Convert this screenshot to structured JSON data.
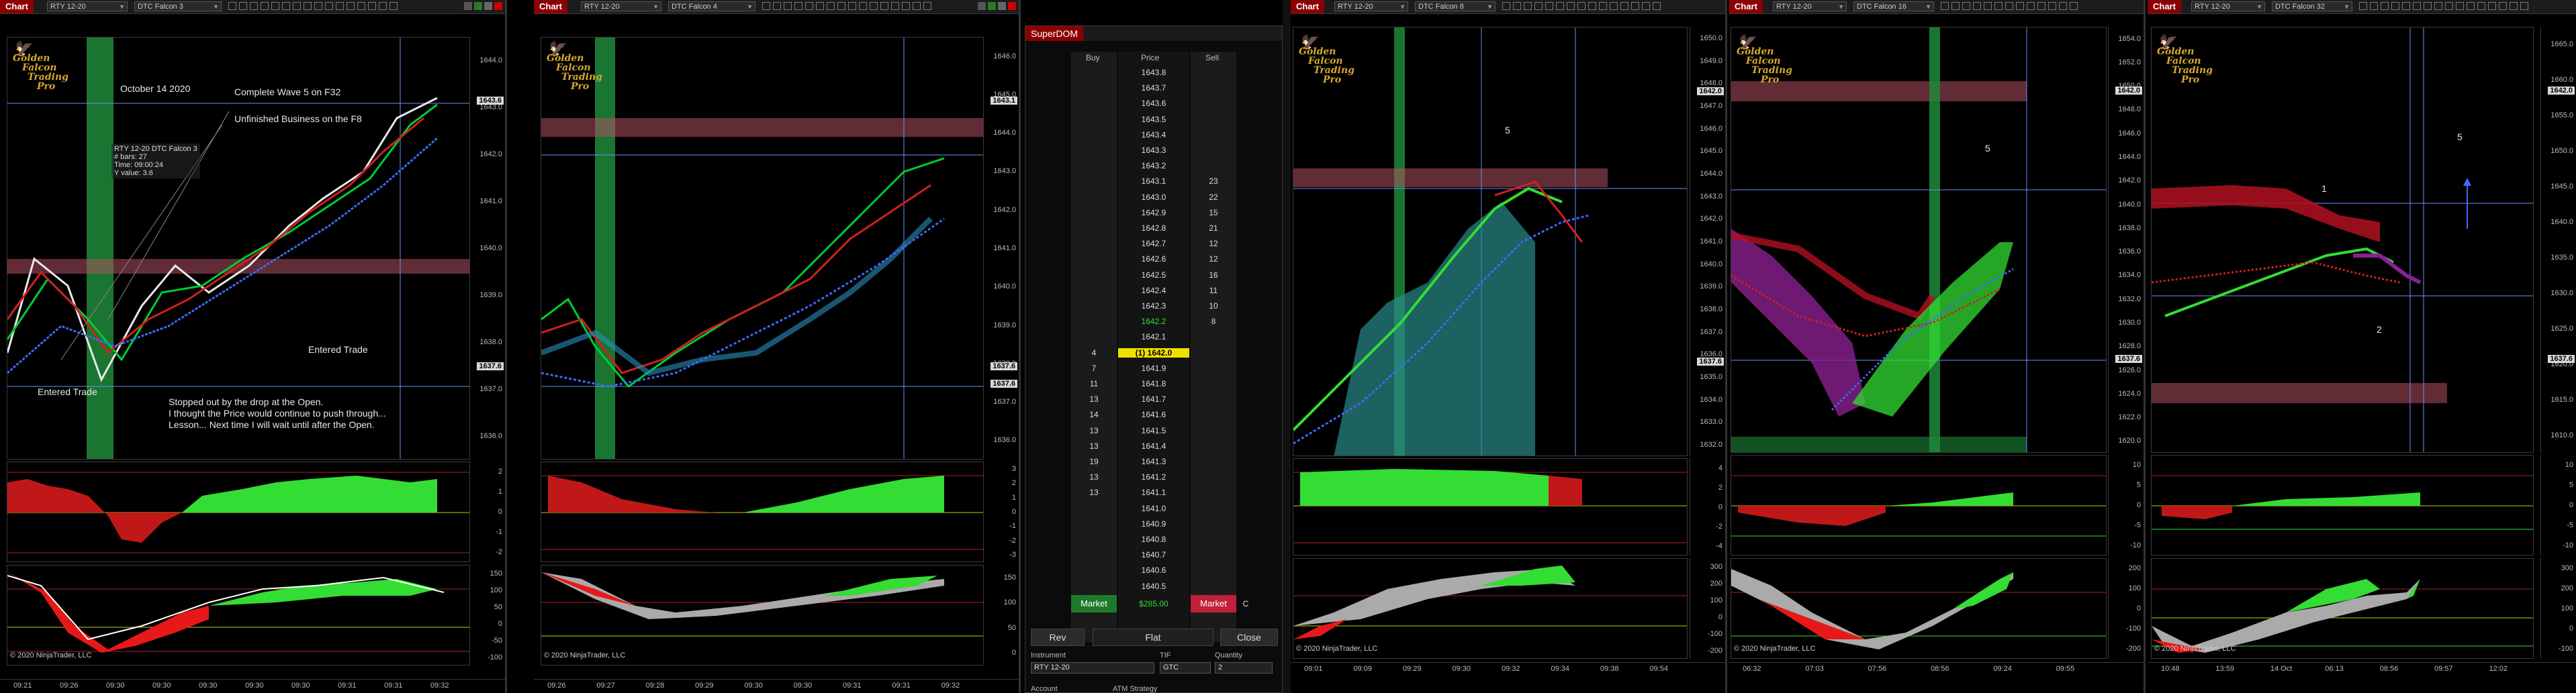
{
  "windows": [
    {
      "tab": "Chart",
      "instrument": "RTY 12-20",
      "template": "DTC Falcon 3"
    },
    {
      "tab": "Chart",
      "instrument": "RTY 12-20",
      "template": "DTC Falcon 4"
    },
    {
      "tab": "Chart",
      "instrument": "RTY 12-20",
      "template": "DTC Falcon 8"
    },
    {
      "tab": "Chart",
      "instrument": "RTY 12-20",
      "template": "DTC Falcon 16"
    },
    {
      "tab": "Chart",
      "instrument": "RTY 12-20",
      "template": "DTC Falcon 32"
    }
  ],
  "logo": {
    "line1": "Golden",
    "line2": "Falcon",
    "line3": "Trading",
    "line4": "Pro"
  },
  "copyright": "© 2020 NinjaTrader, LLC",
  "chart1": {
    "date_note": "October 14 2020",
    "note_wave": "Complete Wave 5 on F32",
    "note_unfinished": "Unfinished Business on the F8",
    "note_entered_right": "Entered Trade",
    "note_entered_left": "Entered Trade",
    "note_stopped_1": "Stopped out by the drop at the Open.",
    "note_stopped_2": "I thought the Price would continue to push through...",
    "note_stopped_3": "Lesson... Next time I will wait until after the Open.",
    "databox": [
      "RTY 12-20  DTC Falcon 3",
      "# bars:    27",
      "Time:      09:00:24",
      "Y value:  3.6"
    ],
    "price_ticks": [
      "1644.0",
      "1643.0",
      "1642.0",
      "1641.0",
      "1640.0",
      "1639.0",
      "1638.0",
      "1637.0",
      "1636.0"
    ],
    "price_flags": [
      "1643.6",
      "1637.6"
    ],
    "osc1_ticks": [
      "2",
      "1",
      "0",
      "-1",
      "-2"
    ],
    "osc2_ticks": [
      "150",
      "100",
      "50",
      "0",
      "-50",
      "-100"
    ],
    "times": [
      "09:21",
      "09:26",
      "09:30",
      "09:30",
      "09:30",
      "09:30",
      "09:30",
      "09:31",
      "09:31",
      "09:32"
    ]
  },
  "chart2": {
    "price_ticks": [
      "1646.0",
      "1645.0",
      "1644.0",
      "1643.0",
      "1642.0",
      "1641.0",
      "1640.0",
      "1639.0",
      "1638.0",
      "1637.0",
      "1636.0"
    ],
    "price_flags": [
      "1643.1",
      "1637.6",
      "1637.6"
    ],
    "osc1_ticks": [
      "3",
      "2",
      "1",
      "0",
      "-1",
      "-2",
      "-3"
    ],
    "osc2_ticks": [
      "150",
      "100",
      "50",
      "0"
    ],
    "times": [
      "09:26",
      "09:27",
      "09:28",
      "09:29",
      "09:30",
      "09:30",
      "09:31",
      "09:31",
      "09:32"
    ]
  },
  "superdom": {
    "tab": "SuperDOM",
    "hdr_buy": "Buy",
    "hdr_price": "Price",
    "hdr_sell": "Sell",
    "rows": [
      {
        "buy": "",
        "price": "1643.8",
        "sell": ""
      },
      {
        "buy": "",
        "price": "1643.7",
        "sell": ""
      },
      {
        "buy": "",
        "price": "1643.6",
        "sell": ""
      },
      {
        "buy": "",
        "price": "1643.5",
        "sell": ""
      },
      {
        "buy": "",
        "price": "1643.4",
        "sell": ""
      },
      {
        "buy": "",
        "price": "1643.3",
        "sell": ""
      },
      {
        "buy": "",
        "price": "1643.2",
        "sell": ""
      },
      {
        "buy": "",
        "price": "1643.1",
        "sell": "23"
      },
      {
        "buy": "",
        "price": "1643.0",
        "sell": "22"
      },
      {
        "buy": "",
        "price": "1642.9",
        "sell": "15"
      },
      {
        "buy": "",
        "price": "1642.8",
        "sell": "21"
      },
      {
        "buy": "",
        "price": "1642.7",
        "sell": "12"
      },
      {
        "buy": "",
        "price": "1642.6",
        "sell": "12"
      },
      {
        "buy": "",
        "price": "1642.5",
        "sell": "16"
      },
      {
        "buy": "",
        "price": "1642.4",
        "sell": "11"
      },
      {
        "buy": "",
        "price": "1642.3",
        "sell": "10"
      },
      {
        "buy": "",
        "price": "1642.2",
        "sell": "8"
      },
      {
        "buy": "",
        "price": "1642.1",
        "sell": ""
      },
      {
        "buy": "4",
        "price": "(1) 1642.0",
        "sell": ""
      },
      {
        "buy": "7",
        "price": "1641.9",
        "sell": ""
      },
      {
        "buy": "11",
        "price": "1641.8",
        "sell": ""
      },
      {
        "buy": "13",
        "price": "1641.7",
        "sell": ""
      },
      {
        "buy": "14",
        "price": "1641.6",
        "sell": ""
      },
      {
        "buy": "13",
        "price": "1641.5",
        "sell": ""
      },
      {
        "buy": "13",
        "price": "1641.4",
        "sell": ""
      },
      {
        "buy": "19",
        "price": "1641.3",
        "sell": ""
      },
      {
        "buy": "13",
        "price": "1641.2",
        "sell": ""
      },
      {
        "buy": "13",
        "price": "1641.1",
        "sell": ""
      },
      {
        "buy": "",
        "price": "1641.0",
        "sell": ""
      },
      {
        "buy": "",
        "price": "1640.9",
        "sell": ""
      },
      {
        "buy": "",
        "price": "1640.8",
        "sell": ""
      },
      {
        "buy": "",
        "price": "1640.7",
        "sell": ""
      },
      {
        "buy": "",
        "price": "1640.6",
        "sell": ""
      },
      {
        "buy": "",
        "price": "1640.5",
        "sell": ""
      }
    ],
    "market_buy": "Market",
    "pnl": "$285.00",
    "market_sell": "Market",
    "c_label": "C",
    "rev": "Rev",
    "flat": "Flat",
    "close": "Close",
    "lbl_instrument": "Instrument",
    "lbl_tif": "TIF",
    "lbl_quantity": "Quantity",
    "instrument": "RTY 12-20",
    "tif": "GTC",
    "quantity": "2",
    "lbl_account": "Account",
    "lbl_atm": "ATM Strategy"
  },
  "chart3": {
    "wave_label": "5",
    "price_ticks": [
      "1650.0",
      "1649.0",
      "1648.0",
      "1647.0",
      "1646.0",
      "1645.0",
      "1644.0",
      "1643.0",
      "1642.0",
      "1641.0",
      "1640.0",
      "1639.0",
      "1638.0",
      "1637.0",
      "1636.0",
      "1635.0",
      "1634.0",
      "1633.0",
      "1632.0"
    ],
    "price_flags": [
      "1642.0",
      "1637.6"
    ],
    "osc1_ticks": [
      "4",
      "2",
      "0",
      "-2",
      "-4"
    ],
    "osc2_ticks": [
      "300",
      "200",
      "100",
      "0",
      "-100",
      "-200"
    ],
    "times": [
      "09:01",
      "09:09",
      "09:29",
      "09:30",
      "09:32",
      "09:34",
      "09:38",
      "09:54"
    ]
  },
  "chart4": {
    "wave_label": "5",
    "price_ticks": [
      "1654.0",
      "1652.0",
      "1650.0",
      "1648.0",
      "1646.0",
      "1644.0",
      "1642.0",
      "1640.0",
      "1638.0",
      "1636.0",
      "1634.0",
      "1632.0",
      "1630.0",
      "1628.0",
      "1626.0",
      "1624.0",
      "1622.0",
      "1620.0"
    ],
    "price_flags": [
      "1642.0",
      "1637.6"
    ],
    "osc1_ticks": [
      "10",
      "5",
      "0",
      "-5",
      "-10"
    ],
    "osc2_ticks": [
      "200",
      "100",
      "0",
      "-100",
      "-200"
    ],
    "times": [
      "06:32",
      "07:03",
      "07:56",
      "08:56",
      "09:24",
      "09:55"
    ]
  },
  "chart5": {
    "labels": [
      "5",
      "1",
      "2"
    ],
    "price_ticks": [
      "1665.0",
      "1660.0",
      "1655.0",
      "1650.0",
      "1645.0",
      "1640.0",
      "1635.0",
      "1630.0",
      "1625.0",
      "1620.0",
      "1615.0",
      "1610.0"
    ],
    "price_flags": [
      "1642.0",
      "1637.6"
    ],
    "osc1_ticks": [
      "10",
      "5",
      "0",
      "-5",
      "-10"
    ],
    "osc2_ticks": [
      "300",
      "200",
      "100",
      "0",
      "-100"
    ],
    "times": [
      "10:48",
      "13:59",
      "14 Oct",
      "06:13",
      "08:56",
      "09:57",
      "12:02"
    ]
  }
}
